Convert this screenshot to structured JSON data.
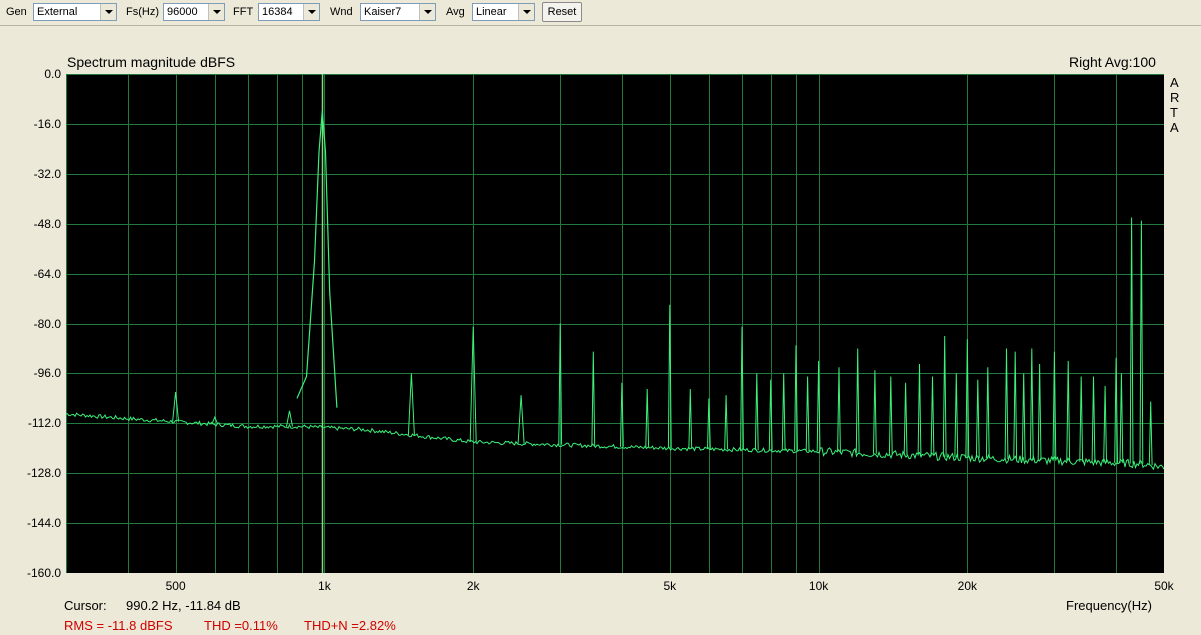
{
  "toolbar": {
    "gen_label": "Gen",
    "gen_value": "External",
    "fs_label": "Fs(Hz)",
    "fs_value": "96000",
    "fft_label": "FFT",
    "fft_value": "16384",
    "wnd_label": "Wnd",
    "wnd_value": "Kaiser7",
    "avg_label": "Avg",
    "avg_value": "Linear",
    "reset_label": "Reset"
  },
  "chart_data": {
    "type": "line",
    "title": "Spectrum magnitude dBFS",
    "channel_info": "Right  Avg:100",
    "brand_letters": [
      "A",
      "R",
      "T",
      "A"
    ],
    "xlabel": "Frequency(Hz)",
    "ylabel": "",
    "x_scale": "log",
    "xlim": [
      300,
      50000
    ],
    "ylim": [
      -160,
      0
    ],
    "grid": true,
    "line_color": "#3cf07a",
    "background": "#000000",
    "grid_color": "#1f7a3c",
    "y_ticks": [
      "0.0",
      "-16.0",
      "-32.0",
      "-48.0",
      "-64.0",
      "-80.0",
      "-96.0",
      "-112.0",
      "-128.0",
      "-144.0",
      "-160.0"
    ],
    "x_ticks": [
      "500",
      "1k",
      "2k",
      "5k",
      "10k",
      "20k",
      "50k"
    ],
    "x_tick_values": [
      500,
      1000,
      2000,
      5000,
      10000,
      20000,
      50000
    ],
    "cursor_freq": 990.2,
    "fundamental": {
      "freq": 990.2,
      "level": -11.8
    },
    "noise_floor": [
      [
        300,
        -109
      ],
      [
        400,
        -110.5
      ],
      [
        700,
        -113
      ],
      [
        880,
        -113
      ],
      [
        1200,
        -114
      ],
      [
        2000,
        -118
      ],
      [
        5000,
        -120
      ],
      [
        10000,
        -121
      ],
      [
        20000,
        -123
      ],
      [
        45000,
        -125
      ],
      [
        50000,
        -126
      ]
    ],
    "peaks": [
      {
        "freq": 500,
        "level": -102
      },
      {
        "freq": 600,
        "level": -110
      },
      {
        "freq": 850,
        "level": -108
      },
      {
        "freq": 1500,
        "level": -96
      },
      {
        "freq": 2000,
        "level": -81
      },
      {
        "freq": 2500,
        "level": -103
      },
      {
        "freq": 3000,
        "level": -80
      },
      {
        "freq": 3500,
        "level": -89
      },
      {
        "freq": 4000,
        "level": -99
      },
      {
        "freq": 4500,
        "level": -101
      },
      {
        "freq": 5000,
        "level": -74
      },
      {
        "freq": 5500,
        "level": -101
      },
      {
        "freq": 6000,
        "level": -104
      },
      {
        "freq": 6500,
        "level": -103
      },
      {
        "freq": 7000,
        "level": -81
      },
      {
        "freq": 7500,
        "level": -96
      },
      {
        "freq": 8000,
        "level": -98
      },
      {
        "freq": 8500,
        "level": -96
      },
      {
        "freq": 9000,
        "level": -87
      },
      {
        "freq": 9500,
        "level": -97
      },
      {
        "freq": 10000,
        "level": -92
      },
      {
        "freq": 11000,
        "level": -94
      },
      {
        "freq": 12000,
        "level": -88
      },
      {
        "freq": 13000,
        "level": -95
      },
      {
        "freq": 14000,
        "level": -97
      },
      {
        "freq": 15000,
        "level": -99
      },
      {
        "freq": 16000,
        "level": -93
      },
      {
        "freq": 17000,
        "level": -97
      },
      {
        "freq": 18000,
        "level": -84
      },
      {
        "freq": 19000,
        "level": -96
      },
      {
        "freq": 20000,
        "level": -85
      },
      {
        "freq": 21000,
        "level": -98
      },
      {
        "freq": 22000,
        "level": -94
      },
      {
        "freq": 24000,
        "level": -88
      },
      {
        "freq": 25000,
        "level": -89
      },
      {
        "freq": 26000,
        "level": -96
      },
      {
        "freq": 27000,
        "level": -88
      },
      {
        "freq": 28000,
        "level": -93
      },
      {
        "freq": 30000,
        "level": -89
      },
      {
        "freq": 32000,
        "level": -92
      },
      {
        "freq": 34000,
        "level": -97
      },
      {
        "freq": 36000,
        "level": -97
      },
      {
        "freq": 38000,
        "level": -100
      },
      {
        "freq": 40000,
        "level": -91
      },
      {
        "freq": 41000,
        "level": -96
      },
      {
        "freq": 43000,
        "level": -46
      },
      {
        "freq": 45000,
        "level": -47
      },
      {
        "freq": 47000,
        "level": -105
      }
    ]
  },
  "cursor_label": "Cursor:",
  "cursor_value": "990.2 Hz, -11.84 dB",
  "stats": {
    "rms": "RMS =  -11.8 dBFS",
    "thd": "THD =0.11%",
    "thdn": "THD+N =2.82%"
  }
}
